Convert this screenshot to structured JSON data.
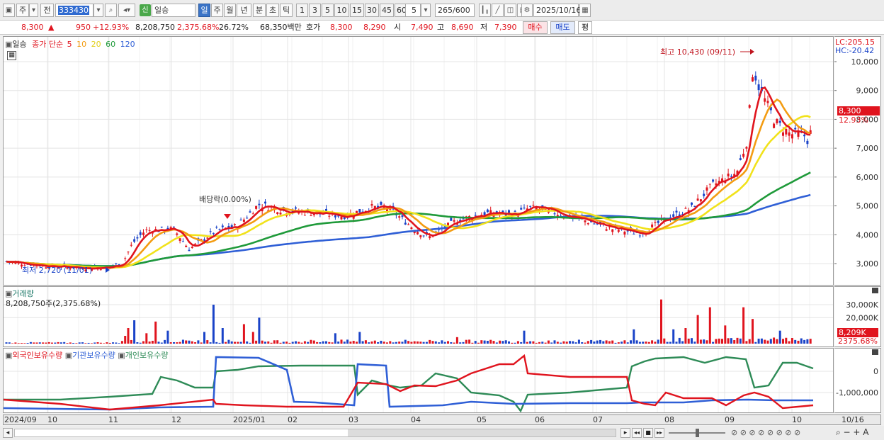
{
  "toolbar": {
    "period_short": "주",
    "prev_label": "전",
    "code": "333430",
    "badge": "신",
    "stock_name": "일승",
    "periods": [
      "일",
      "주",
      "월",
      "년",
      "분",
      "초",
      "틱"
    ],
    "ticks": [
      "1",
      "3",
      "5",
      "10",
      "15",
      "30",
      "45",
      "60"
    ],
    "count_select": "5",
    "count": "265",
    "count_total": "/600",
    "date": "2025/10/16"
  },
  "quote": {
    "price": "8,300",
    "direction": "▲",
    "change": "950",
    "change_pct": "+12.93%",
    "volume": "8,208,750",
    "volume_ratio": "2,375.68%",
    "turnover": "26.72%",
    "amount": "68,350백만",
    "bid_label": "호가",
    "bid1": "8,300",
    "bid2": "8,290",
    "open_label": "시",
    "open": "7,490",
    "high_label": "고",
    "high": "8,690",
    "low_label": "저",
    "low": "7,390",
    "buy": "매수",
    "sell": "매도",
    "avg": "평"
  },
  "price_panel": {
    "stock": "일승",
    "legend_title": "종가 단순",
    "ma": [
      {
        "label": "5",
        "color": "#e0141e"
      },
      {
        "label": "10",
        "color": "#f39c12"
      },
      {
        "label": "20",
        "color": "#f1e21b"
      },
      {
        "label": "60",
        "color": "#1f9a3a"
      },
      {
        "label": "120",
        "color": "#2f5fd6"
      }
    ],
    "lc": "LC:205.15",
    "hc": "HC:-20.42",
    "max_label": "최고 10,430 (09/11)",
    "min_label": "최저 2,720 (11/01)",
    "dividend_label": "배당락(0.00%)",
    "current_tag": "8,300",
    "current_pct": "12.93%"
  },
  "volume_panel": {
    "title": "거래량",
    "value": "8,208,750주(2,375.68%)",
    "current_tag": "8,209K",
    "current_pct": "2375.68%"
  },
  "holder_panel": {
    "legend": [
      {
        "label": "외국인보유수량",
        "color": "#e0141e"
      },
      {
        "label": "기관보유수량",
        "color": "#2f5fd6"
      },
      {
        "label": "개인보유수량",
        "color": "#2e8b57"
      }
    ]
  },
  "date_axis": [
    "2024/09",
    "10",
    "11",
    "12",
    "2025/01",
    "02",
    "03",
    "04",
    "05",
    "06",
    "07",
    "08",
    "09",
    "10"
  ],
  "date_end": "10/16",
  "chart_data": {
    "type": "candlestick",
    "price_ticks": [
      10000,
      9000,
      8000,
      7000,
      6000,
      5000,
      4000,
      3000
    ],
    "price_tick_labels": [
      "10,000",
      "9,000",
      "8,000",
      "7,000",
      "6,000",
      "5,000",
      "4,000",
      "3,000"
    ],
    "volume_ticks": [
      30000,
      20000
    ],
    "volume_tick_labels": [
      "30,000K",
      "20,000K"
    ],
    "holder_ticks": [
      0,
      -1000000
    ],
    "holder_tick_labels": [
      "0",
      "-1,000,000"
    ],
    "ylim": [
      2500,
      10500
    ],
    "high": 10430,
    "low": 2720,
    "last": 8300
  }
}
